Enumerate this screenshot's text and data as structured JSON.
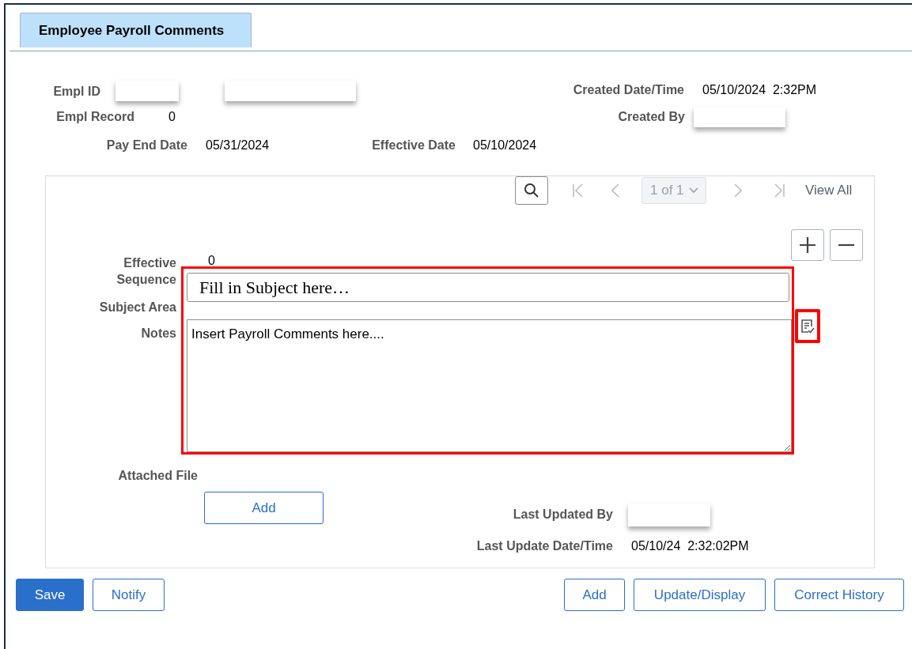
{
  "tab": {
    "label": "Employee Payroll Comments",
    "selected": true
  },
  "header": {
    "empl_id": {
      "label": "Empl ID"
    },
    "created_datetime": {
      "label": "Created Date/Time",
      "value": "05/10/2024  2:32PM"
    },
    "empl_record": {
      "label": "Empl Record",
      "value": "0"
    },
    "created_by": {
      "label": "Created By"
    },
    "pay_end_date": {
      "label": "Pay End Date",
      "value": "05/31/2024"
    },
    "effective_date": {
      "label": "Effective Date",
      "value": "05/10/2024"
    }
  },
  "pager": {
    "page": "1 of 1",
    "view_all": "View All",
    "nav_disabled": true
  },
  "form": {
    "effective_sequence": {
      "label": "Effective Sequence",
      "value": "0"
    },
    "subject_area": {
      "label": "Subject Area",
      "value": "Fill in Subject here…"
    },
    "notes": {
      "label": "Notes",
      "value": "Insert Payroll Comments here...."
    },
    "highlighted": true,
    "spellcheck_highlighted": true,
    "attached_file": {
      "label": "Attached File",
      "button": "Add"
    },
    "last_updated_by": {
      "label": "Last Updated By"
    },
    "last_update_datetime": {
      "label": "Last Update Date/Time",
      "value": "05/10/24  2:32:02PM"
    }
  },
  "buttons_left": [
    {
      "label": "Save",
      "kind": "primary"
    },
    {
      "label": "Notify",
      "kind": "secondary"
    }
  ],
  "buttons_right": [
    {
      "label": "Add",
      "kind": "secondary"
    },
    {
      "label": "Update/Display",
      "kind": "secondary"
    },
    {
      "label": "Correct History",
      "kind": "secondary"
    }
  ]
}
